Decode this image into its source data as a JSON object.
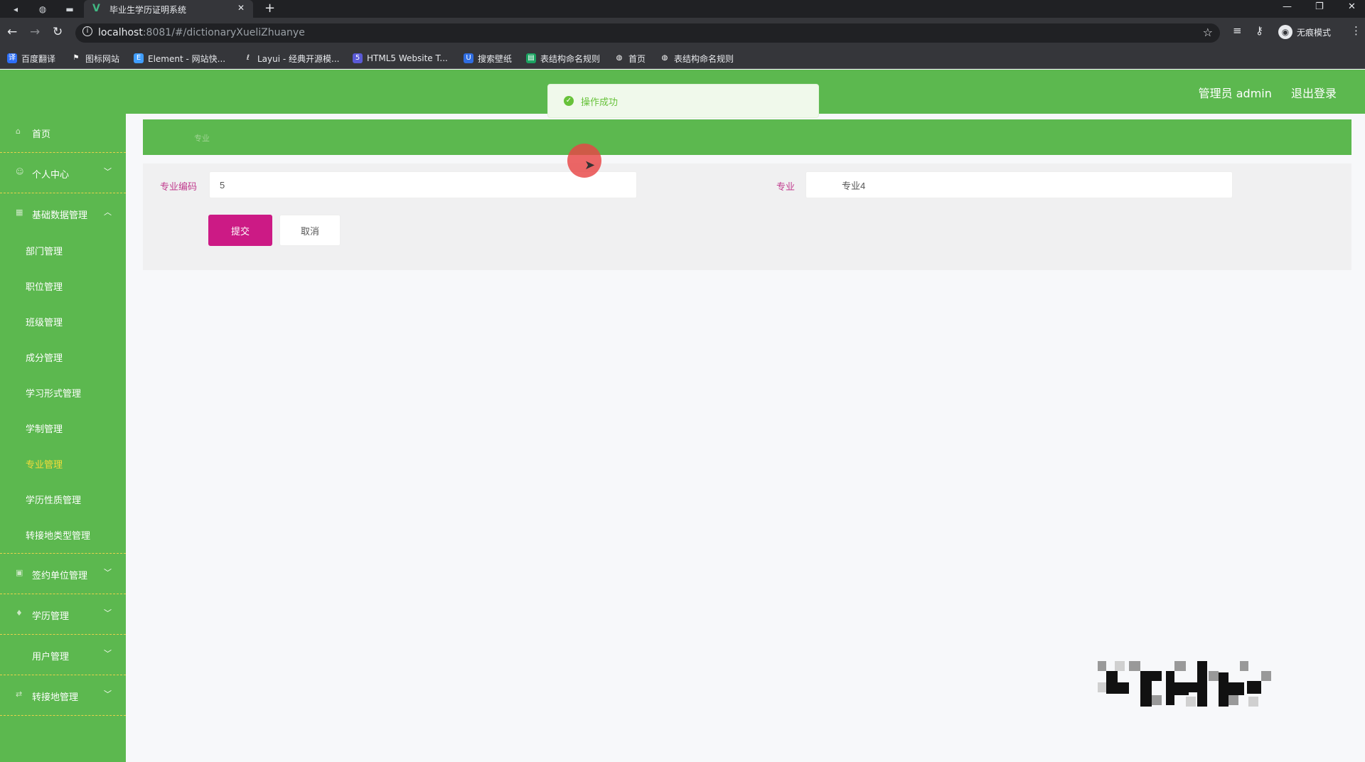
{
  "browser": {
    "tab_title": "毕业生学历证明系统",
    "url_host": "localhost",
    "url_rest": ":8081/#/dictionaryXueliZhuanye",
    "profile_label": "无痕模式",
    "bookmarks": [
      {
        "label": "百度翻译",
        "icon": "baidu-translate-icon",
        "color": "#2d6ff7"
      },
      {
        "label": "图标网站",
        "icon": "flag-icon",
        "color": "#3c3c3c"
      },
      {
        "label": "Element - 网站快...",
        "icon": "element-icon",
        "color": "#409eff"
      },
      {
        "label": "Layui - 经典开源模...",
        "icon": "layui-icon",
        "color": "#3c3c3c"
      },
      {
        "label": "HTML5 Website T...",
        "icon": "html5-icon",
        "color": "#5a5ad6"
      },
      {
        "label": "搜索壁纸",
        "icon": "wallpaper-icon",
        "color": "#2f6de1"
      },
      {
        "label": "表结构命名规则",
        "icon": "sheet-icon",
        "color": "#1aa260"
      },
      {
        "label": "首页",
        "icon": "globe-icon",
        "color": "#555"
      },
      {
        "label": "表结构命名规则",
        "icon": "globe-icon",
        "color": "#555"
      }
    ]
  },
  "header": {
    "user_label": "管理员 admin",
    "logout_label": "退出登录"
  },
  "toast": {
    "message": "操作成功",
    "status_color": "#67c23a"
  },
  "sidebar": {
    "accent_color": "#f5dc3a",
    "items": [
      {
        "label": "首页",
        "icon": "home-icon",
        "has_children": false
      },
      {
        "label": "个人中心",
        "icon": "user-icon",
        "has_children": true,
        "expanded": false
      },
      {
        "label": "基础数据管理",
        "icon": "data-icon",
        "has_children": true,
        "expanded": true,
        "children": [
          {
            "label": "部门管理"
          },
          {
            "label": "职位管理"
          },
          {
            "label": "班级管理"
          },
          {
            "label": "成分管理"
          },
          {
            "label": "学习形式管理"
          },
          {
            "label": "学制管理"
          },
          {
            "label": "专业管理",
            "active": true
          },
          {
            "label": "学历性质管理"
          },
          {
            "label": "转接地类型管理"
          }
        ]
      },
      {
        "label": "签约单位管理",
        "icon": "building-icon",
        "has_children": true,
        "expanded": false
      },
      {
        "label": "学历管理",
        "icon": "cap-icon",
        "has_children": true,
        "expanded": false
      },
      {
        "label": "用户管理",
        "icon": "users-icon",
        "has_children": true,
        "expanded": false
      },
      {
        "label": "转接地管理",
        "icon": "transfer-icon",
        "has_children": true,
        "expanded": false
      }
    ]
  },
  "breadcrumb": {
    "current": "专业"
  },
  "form": {
    "code_label": "专业编码",
    "code_value": "5",
    "name_label": "专业",
    "name_value": "专业4",
    "submit_label": "提交",
    "cancel_label": "取消",
    "submit_color": "#cc1a85"
  }
}
